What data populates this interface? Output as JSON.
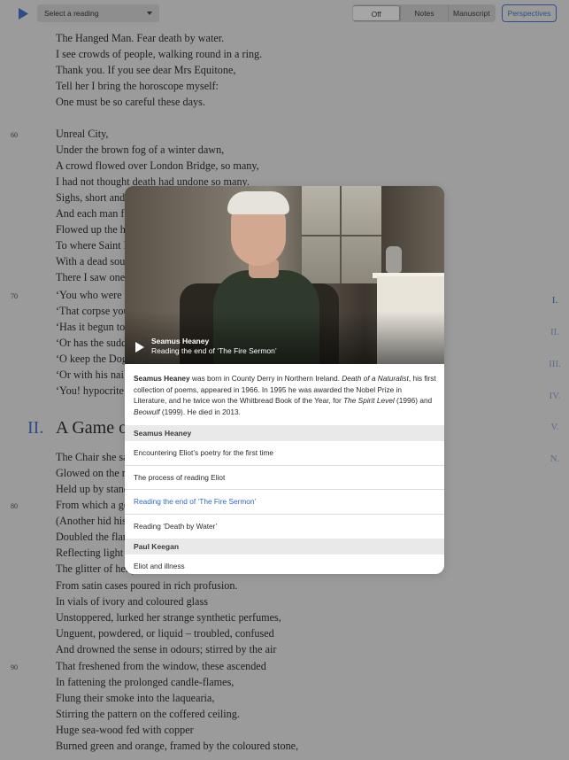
{
  "toolbar": {
    "play_icon": "play-icon",
    "reading_select": "Select a reading",
    "view_modes": [
      "Off",
      "Notes",
      "Manuscript"
    ],
    "active_mode": "Off",
    "perspectives_label": "Perspectives",
    "accent": "#2c4d8a"
  },
  "poem": {
    "lines_a": [
      "The Hanged Man. Fear death by water.",
      "I see crowds of people, walking round in a ring.",
      "Thank you. If you see dear Mrs Equitone,",
      "Tell her I bring the horoscope myself:",
      "One must be so careful these days."
    ],
    "lines_b": [
      "Unreal City,",
      "Under the brown fog of a winter dawn,",
      "A crowd flowed over London Bridge, so many,",
      "I had not thought death had undone so many.",
      "Sighs, short and i",
      "And each man fix",
      "Flowed up the hil",
      "To where Saint M",
      "With a dead soun",
      "There I saw one I",
      "‘You who were w",
      "‘That corpse you",
      "‘Has it begun to s",
      "‘Or has the sudde",
      "‘O keep the Dog",
      "‘You! hypocrite le"
    ],
    "line_nums": [
      "60",
      "70",
      "80",
      "90"
    ],
    "section_number": "II.",
    "section_title": "A Game o",
    "lines_c": [
      "The Chair she sat",
      "Glowed on the m",
      "Held up by stand",
      "From which a go",
      "(Another hid his",
      "Doubled the flam",
      "Reflecting light u",
      "The glitter of her j",
      "From satin cases poured in rich profusion.",
      "In vials of ivory and coloured glass",
      "Unstoppered, lurked her strange synthetic perfumes,",
      "Unguent, powdered, or liquid – troubled, confused",
      "And drowned the sense in odours; stirred by the air",
      "That freshened from the window, these ascended",
      "In fattening the prolonged candle-flames,",
      "Flung their smoke into the laquearia,",
      "Stirring the pattern on the coffered ceiling.",
      "Huge sea-wood fed with copper",
      "Burned green and orange, framed by the coloured stone,"
    ],
    "line_frag_70": "‘Or with his nails"
  },
  "section_nav": [
    "I.",
    "II.",
    "III.",
    "IV.",
    "V.",
    "N."
  ],
  "section_nav_active": "I.",
  "modal": {
    "video": {
      "speaker": "Seamus Heaney",
      "caption": "Reading the end of ‘The Fire Sermon’",
      "play_icon": "play-icon"
    },
    "bio": {
      "name": "Seamus Heaney",
      "t1": " was born in County Derry in Northern Ireland. ",
      "book1": "Death of a Naturalist",
      "t2": ", his first collection of poems, appeared in 1966. In 1995 he was awarded the Nobel Prize in Literature, and he twice won the Whitbread Book of the Year, for ",
      "book2": "The Spirit Level",
      "t3": " (1996) and ",
      "book3": "Beowulf",
      "t4": " (1999). He died in 2013."
    },
    "groups": [
      {
        "heading": "Seamus Heaney",
        "items": [
          "Encountering Eliot’s poetry for the first time",
          "The process of reading Eliot",
          "Reading the end of ‘The Fire Sermon’",
          "Reading ‘Death by Water’"
        ]
      },
      {
        "heading": "Paul Keegan",
        "items": [
          "Eliot and illness"
        ]
      }
    ],
    "current_item": "Reading the end of ‘The Fire Sermon’",
    "current_color": "#2f67c5"
  }
}
